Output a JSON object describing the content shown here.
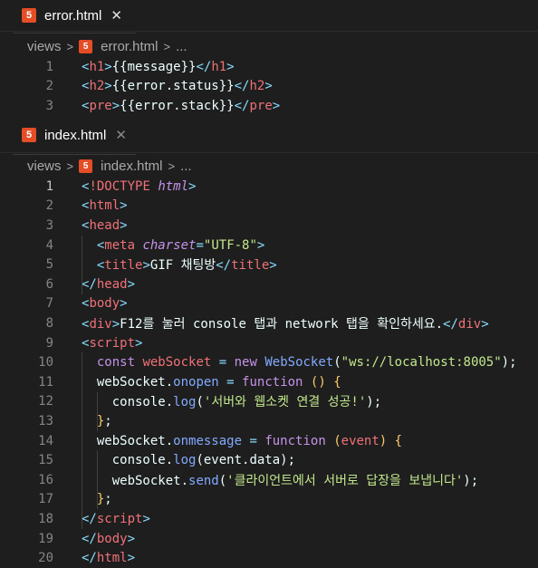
{
  "tab1": {
    "name": "error.html",
    "breadcrumb": [
      "views",
      "error.html",
      "..."
    ]
  },
  "tab2": {
    "name": "index.html",
    "breadcrumb": [
      "views",
      "index.html",
      "..."
    ]
  },
  "icons": {
    "html": "5",
    "close": "✕",
    "chevron": ">"
  },
  "error_lines": [
    {
      "n": "1",
      "parts": [
        {
          "c": "p",
          "t": "<"
        },
        {
          "c": "t",
          "t": "h1"
        },
        {
          "c": "p",
          "t": ">"
        },
        {
          "c": "x",
          "t": "{{message}}"
        },
        {
          "c": "p",
          "t": "</"
        },
        {
          "c": "t",
          "t": "h1"
        },
        {
          "c": "p",
          "t": ">"
        }
      ]
    },
    {
      "n": "2",
      "parts": [
        {
          "c": "p",
          "t": "<"
        },
        {
          "c": "t",
          "t": "h2"
        },
        {
          "c": "p",
          "t": ">"
        },
        {
          "c": "x",
          "t": "{{error.status}}"
        },
        {
          "c": "p",
          "t": "</"
        },
        {
          "c": "t",
          "t": "h2"
        },
        {
          "c": "p",
          "t": ">"
        }
      ]
    },
    {
      "n": "3",
      "parts": [
        {
          "c": "p",
          "t": "<"
        },
        {
          "c": "t",
          "t": "pre"
        },
        {
          "c": "p",
          "t": ">"
        },
        {
          "c": "x",
          "t": "{{error.stack}}"
        },
        {
          "c": "p",
          "t": "</"
        },
        {
          "c": "t",
          "t": "pre"
        },
        {
          "c": "p",
          "t": ">"
        }
      ]
    }
  ],
  "index_lines": [
    {
      "n": "1",
      "parts": [
        {
          "c": "p",
          "t": "<"
        },
        {
          "c": "t",
          "t": "!DOCTYPE"
        },
        {
          "c": "x",
          "t": " "
        },
        {
          "c": "a",
          "t": "html"
        },
        {
          "c": "p",
          "t": ">"
        }
      ]
    },
    {
      "n": "2",
      "parts": [
        {
          "c": "p",
          "t": "<"
        },
        {
          "c": "t",
          "t": "html"
        },
        {
          "c": "p",
          "t": ">"
        }
      ]
    },
    {
      "n": "3",
      "parts": [
        {
          "c": "p",
          "t": "<"
        },
        {
          "c": "t",
          "t": "head"
        },
        {
          "c": "p",
          "t": ">"
        }
      ]
    },
    {
      "n": "4",
      "parts": [
        {
          "c": "x",
          "t": "  "
        },
        {
          "c": "p",
          "t": "<"
        },
        {
          "c": "t",
          "t": "meta"
        },
        {
          "c": "x",
          "t": " "
        },
        {
          "c": "a",
          "t": "charset"
        },
        {
          "c": "p",
          "t": "="
        },
        {
          "c": "s",
          "t": "\"UTF-8\""
        },
        {
          "c": "p",
          "t": ">"
        }
      ]
    },
    {
      "n": "5",
      "parts": [
        {
          "c": "x",
          "t": "  "
        },
        {
          "c": "p",
          "t": "<"
        },
        {
          "c": "t",
          "t": "title"
        },
        {
          "c": "p",
          "t": ">"
        },
        {
          "c": "x",
          "t": "GIF 채팅방"
        },
        {
          "c": "p",
          "t": "</"
        },
        {
          "c": "t",
          "t": "title"
        },
        {
          "c": "p",
          "t": ">"
        }
      ]
    },
    {
      "n": "6",
      "parts": [
        {
          "c": "p",
          "t": "</"
        },
        {
          "c": "t",
          "t": "head"
        },
        {
          "c": "p",
          "t": ">"
        }
      ]
    },
    {
      "n": "7",
      "parts": [
        {
          "c": "p",
          "t": "<"
        },
        {
          "c": "t",
          "t": "body"
        },
        {
          "c": "p",
          "t": ">"
        }
      ]
    },
    {
      "n": "8",
      "parts": [
        {
          "c": "p",
          "t": "<"
        },
        {
          "c": "t",
          "t": "div"
        },
        {
          "c": "p",
          "t": ">"
        },
        {
          "c": "x",
          "t": "F12를 눌러 console 탭과 network 탭을 확인하세요."
        },
        {
          "c": "p",
          "t": "</"
        },
        {
          "c": "t",
          "t": "div"
        },
        {
          "c": "p",
          "t": ">"
        }
      ]
    },
    {
      "n": "9",
      "parts": [
        {
          "c": "p",
          "t": "<"
        },
        {
          "c": "t",
          "t": "script"
        },
        {
          "c": "p",
          "t": ">"
        }
      ]
    },
    {
      "n": "10",
      "parts": [
        {
          "c": "x",
          "t": "  "
        },
        {
          "c": "k",
          "t": "const"
        },
        {
          "c": "x",
          "t": " "
        },
        {
          "c": "v",
          "t": "webSocket"
        },
        {
          "c": "x",
          "t": " "
        },
        {
          "c": "o",
          "t": "="
        },
        {
          "c": "x",
          "t": " "
        },
        {
          "c": "k",
          "t": "new"
        },
        {
          "c": "x",
          "t": " "
        },
        {
          "c": "f",
          "t": "WebSocket"
        },
        {
          "c": "pl",
          "t": "("
        },
        {
          "c": "s",
          "t": "\"ws://localhost:8005\""
        },
        {
          "c": "pl",
          "t": ");"
        }
      ]
    },
    {
      "n": "11",
      "parts": [
        {
          "c": "x",
          "t": "  "
        },
        {
          "c": "pl",
          "t": "webSocket."
        },
        {
          "c": "f",
          "t": "onopen"
        },
        {
          "c": "x",
          "t": " "
        },
        {
          "c": "o",
          "t": "="
        },
        {
          "c": "x",
          "t": " "
        },
        {
          "c": "k",
          "t": "function"
        },
        {
          "c": "x",
          "t": " "
        },
        {
          "c": "y",
          "t": "()"
        },
        {
          "c": "x",
          "t": " "
        },
        {
          "c": "y",
          "t": "{"
        }
      ]
    },
    {
      "n": "12",
      "parts": [
        {
          "c": "x",
          "t": "    "
        },
        {
          "c": "pl",
          "t": "console."
        },
        {
          "c": "f",
          "t": "log"
        },
        {
          "c": "pl",
          "t": "("
        },
        {
          "c": "s",
          "t": "'서버와 웹소켓 연결 성공!'"
        },
        {
          "c": "pl",
          "t": ");"
        }
      ]
    },
    {
      "n": "13",
      "parts": [
        {
          "c": "x",
          "t": "  "
        },
        {
          "c": "y",
          "t": "}"
        },
        {
          "c": "pl",
          "t": ";"
        }
      ]
    },
    {
      "n": "14",
      "parts": [
        {
          "c": "x",
          "t": "  "
        },
        {
          "c": "pl",
          "t": "webSocket."
        },
        {
          "c": "f",
          "t": "onmessage"
        },
        {
          "c": "x",
          "t": " "
        },
        {
          "c": "o",
          "t": "="
        },
        {
          "c": "x",
          "t": " "
        },
        {
          "c": "k",
          "t": "function"
        },
        {
          "c": "x",
          "t": " "
        },
        {
          "c": "y",
          "t": "("
        },
        {
          "c": "v",
          "t": "event"
        },
        {
          "c": "y",
          "t": ")"
        },
        {
          "c": "x",
          "t": " "
        },
        {
          "c": "y",
          "t": "{"
        }
      ]
    },
    {
      "n": "15",
      "parts": [
        {
          "c": "x",
          "t": "    "
        },
        {
          "c": "pl",
          "t": "console."
        },
        {
          "c": "f",
          "t": "log"
        },
        {
          "c": "pl",
          "t": "(event.data);"
        }
      ]
    },
    {
      "n": "16",
      "parts": [
        {
          "c": "x",
          "t": "    "
        },
        {
          "c": "pl",
          "t": "webSocket."
        },
        {
          "c": "f",
          "t": "send"
        },
        {
          "c": "pl",
          "t": "("
        },
        {
          "c": "s",
          "t": "'클라이언트에서 서버로 답장을 보냅니다'"
        },
        {
          "c": "pl",
          "t": ");"
        }
      ]
    },
    {
      "n": "17",
      "parts": [
        {
          "c": "x",
          "t": "  "
        },
        {
          "c": "y",
          "t": "}"
        },
        {
          "c": "pl",
          "t": ";"
        }
      ]
    },
    {
      "n": "18",
      "parts": [
        {
          "c": "p",
          "t": "</"
        },
        {
          "c": "t",
          "t": "script"
        },
        {
          "c": "p",
          "t": ">"
        }
      ]
    },
    {
      "n": "19",
      "parts": [
        {
          "c": "p",
          "t": "</"
        },
        {
          "c": "t",
          "t": "body"
        },
        {
          "c": "p",
          "t": ">"
        }
      ]
    },
    {
      "n": "20",
      "parts": [
        {
          "c": "p",
          "t": "</"
        },
        {
          "c": "t",
          "t": "html"
        },
        {
          "c": "p",
          "t": ">"
        }
      ]
    }
  ]
}
